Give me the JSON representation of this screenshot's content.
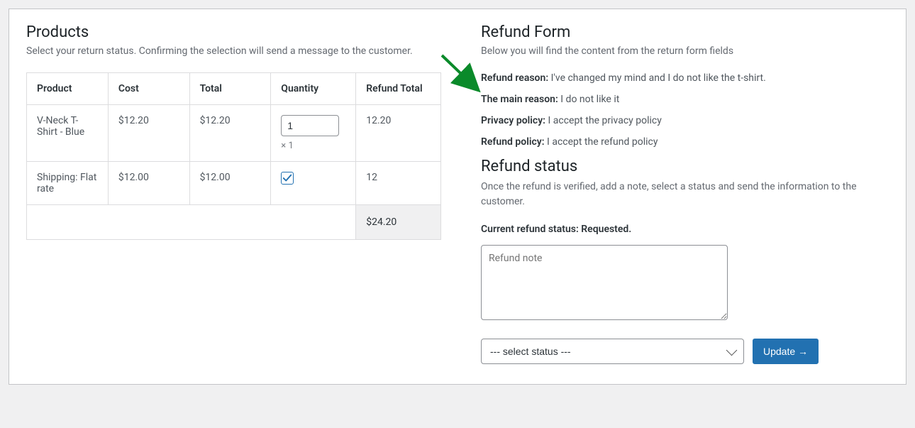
{
  "products": {
    "heading": "Products",
    "subtitle": "Select your return status. Confirming the selection will send a message to the customer.",
    "columns": {
      "product": "Product",
      "cost": "Cost",
      "total": "Total",
      "quantity": "Quantity",
      "refund_total": "Refund Total"
    },
    "rows": [
      {
        "product": "V-Neck T-Shirt - Blue",
        "cost": "$12.20",
        "total": "$12.20",
        "qty_value": "1",
        "qty_mult": "× 1",
        "refund_total": "12.20"
      },
      {
        "product": "Shipping: Flat rate",
        "cost": "$12.00",
        "total": "$12.00",
        "checkbox": true,
        "refund_total": "12"
      }
    ],
    "footer_total": "$24.20"
  },
  "refund_form": {
    "heading": "Refund Form",
    "subtitle": "Below you will find the content from the return form fields",
    "fields": [
      {
        "label": "Refund reason",
        "value": "I've changed my mind and I do not like the t-shirt."
      },
      {
        "label": "The main reason",
        "value": "I do not like it"
      },
      {
        "label": "Privacy policy",
        "value": "I accept the privacy policy"
      },
      {
        "label": "Refund policy",
        "value": "I accept the refund policy"
      }
    ]
  },
  "refund_status": {
    "heading": "Refund status",
    "subtitle": "Once the refund is verified, add a note, select a status and send the information to the customer.",
    "current_label": "Current refund status: Requested.",
    "note_placeholder": "Refund note",
    "select_placeholder": "--- select status ---",
    "update_button": "Update →"
  }
}
